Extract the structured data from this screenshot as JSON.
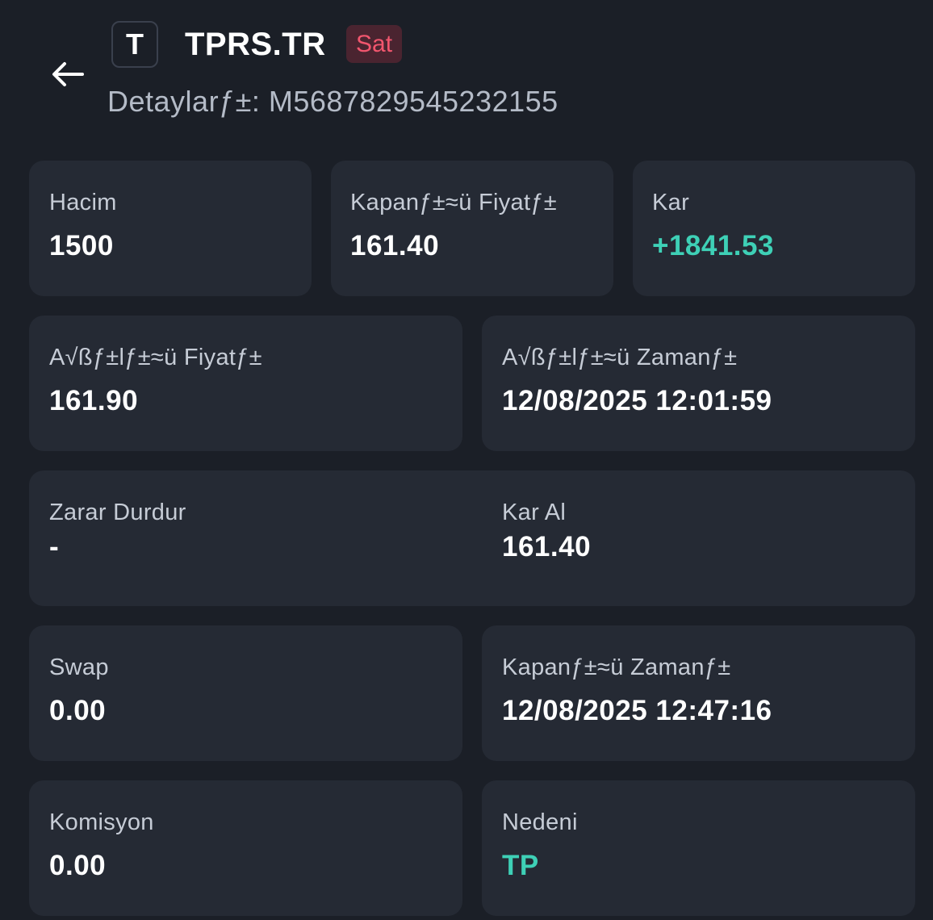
{
  "header": {
    "back_icon": "arrow-left-icon",
    "symbol_initial": "T",
    "symbol": "TPRS.TR",
    "side": "Sat",
    "details_label": "Detaylarƒ±: M5687829545232155"
  },
  "colors": {
    "background": "#1b1f27",
    "card": "#252a34",
    "positive": "#3ed0b6",
    "sell_badge_text": "#f2566e",
    "sell_badge_bg": "#4a2430"
  },
  "fields": {
    "volume": {
      "label": "Hacim",
      "value": "1500"
    },
    "close_price": {
      "label": "Kapanƒ±≈ü Fiyatƒ±",
      "value": "161.40"
    },
    "profit": {
      "label": "Kar",
      "value": "+1841.53"
    },
    "open_price": {
      "label": "A√ßƒ±lƒ±≈ü Fiyatƒ±",
      "value": "161.90"
    },
    "open_time": {
      "label": "A√ßƒ±lƒ±≈ü Zamanƒ±",
      "value": "12/08/2025 12:01:59"
    },
    "stop_loss": {
      "label": "Zarar Durdur",
      "value": "-"
    },
    "take_profit": {
      "label": "Kar Al",
      "value": "161.40"
    },
    "swap": {
      "label": "Swap",
      "value": "0.00"
    },
    "close_time": {
      "label": "Kapanƒ±≈ü Zamanƒ±",
      "value": "12/08/2025 12:47:16"
    },
    "commission": {
      "label": "Komisyon",
      "value": "0.00"
    },
    "reason": {
      "label": "Nedeni",
      "value": "TP"
    }
  }
}
